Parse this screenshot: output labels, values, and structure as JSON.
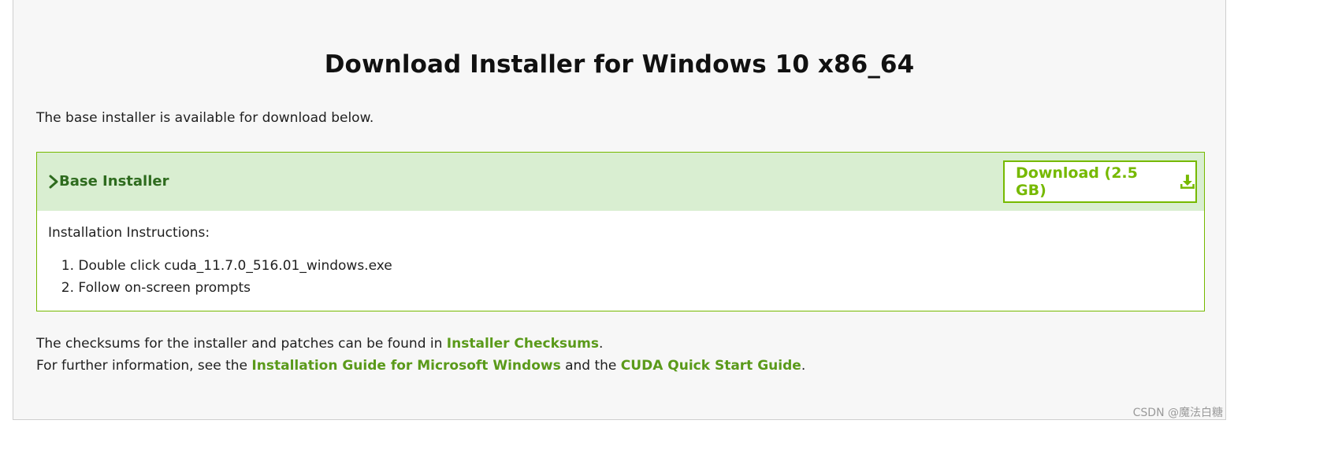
{
  "page": {
    "title": "Download Installer for Windows 10 x86_64",
    "intro": "The base installer is available for download below."
  },
  "installer": {
    "header_label": "Base Installer",
    "download_label": "Download (2.5 GB)",
    "instructions_title": "Installation Instructions:",
    "steps": [
      {
        "num": "1.",
        "text": "Double click cuda_11.7.0_516.01_windows.exe"
      },
      {
        "num": "2.",
        "text": "Follow on-screen prompts"
      }
    ]
  },
  "footer": {
    "line1_prefix": "The checksums for the installer and patches can be found in ",
    "line1_link": "Installer Checksums",
    "line1_suffix": ".",
    "line2_prefix": "For further information, see the ",
    "line2_link1": "Installation Guide for Microsoft Windows",
    "line2_middle": " and the ",
    "line2_link2": "CUDA Quick Start Guide",
    "line2_suffix": "."
  },
  "watermark": "CSDN @魔法白糖",
  "colors": {
    "accent": "#76b900",
    "header_bg": "#d9eed1",
    "header_text": "#2e6b1e",
    "link": "#5a9a1a",
    "panel_bg": "#f7f7f7"
  },
  "icons": {
    "chevron": "chevron-right-icon",
    "download": "download-icon"
  }
}
